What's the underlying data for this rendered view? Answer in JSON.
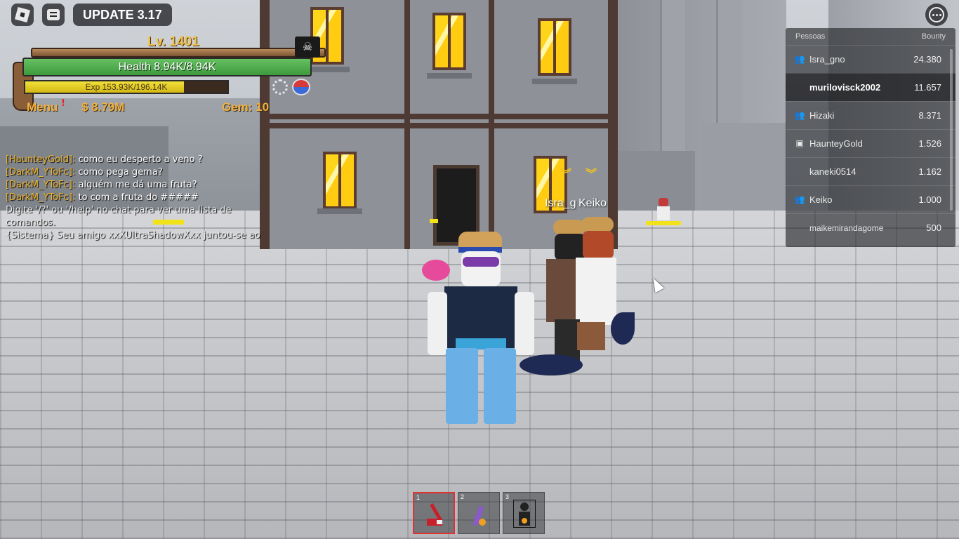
{
  "topbar": {
    "update_label": "UPDATE 3.17"
  },
  "status": {
    "level": "Lv. 1401",
    "health": "Health 8.94K/8.94K",
    "exp": "Exp 153.93K/196.14K",
    "exp_fraction": 0.785,
    "menu_label": "Menu",
    "menu_alert": "!",
    "money": "$ 8.79M",
    "gems": "Gem: 10"
  },
  "chat": {
    "lines": [
      {
        "name": "[HaunteyGold]:",
        "text": "como eu desperto a veno ?"
      },
      {
        "name": "[DarkM_YToFc]:",
        "text": "como pega gema?"
      },
      {
        "name": "[DarkM_YToFc]:",
        "text": "alguém me dá uma fruta?"
      },
      {
        "name": "[DarkM_YToFc]:",
        "text": "to com a fruta do #####"
      }
    ],
    "help_line_1": "Digite '/?' ou '/help' no chat para ver uma lista de",
    "help_line_2": "comandos.",
    "system_line": "{Sistema} Seu amigo xxXUltraShadowXxx juntou-se ao"
  },
  "nametags": {
    "player_a": "Isra_g",
    "player_b": "Keiko"
  },
  "leaderboard": {
    "col_people": "Pessoas",
    "col_bounty": "Bounty",
    "rows": [
      {
        "name": "Isra_gno",
        "bounty": "24.380",
        "icon": "friends-icon"
      },
      {
        "name": "murilovisck2002",
        "bounty": "11.657",
        "icon": ""
      },
      {
        "name": "Hizaki",
        "bounty": "8.371",
        "icon": "friends-icon"
      },
      {
        "name": "HaunteyGold",
        "bounty": "1.526",
        "icon": "premium-icon"
      },
      {
        "name": "kaneki0514",
        "bounty": "1.162",
        "icon": ""
      },
      {
        "name": "Keiko",
        "bounty": "1.000",
        "icon": "friends-icon"
      },
      {
        "name": "maikemirandagome",
        "bounty": "500",
        "icon": ""
      }
    ]
  },
  "hotbar": {
    "slots": [
      {
        "num": "1",
        "item": "red-gun-icon"
      },
      {
        "num": "2",
        "item": "fruit-icon"
      },
      {
        "num": "3",
        "item": "character-icon"
      }
    ]
  },
  "colors": {
    "health": "#4aa84a",
    "exp": "#e8cf2a",
    "accent_gold": "#f0b040",
    "chat_name": "#f1b52c"
  }
}
